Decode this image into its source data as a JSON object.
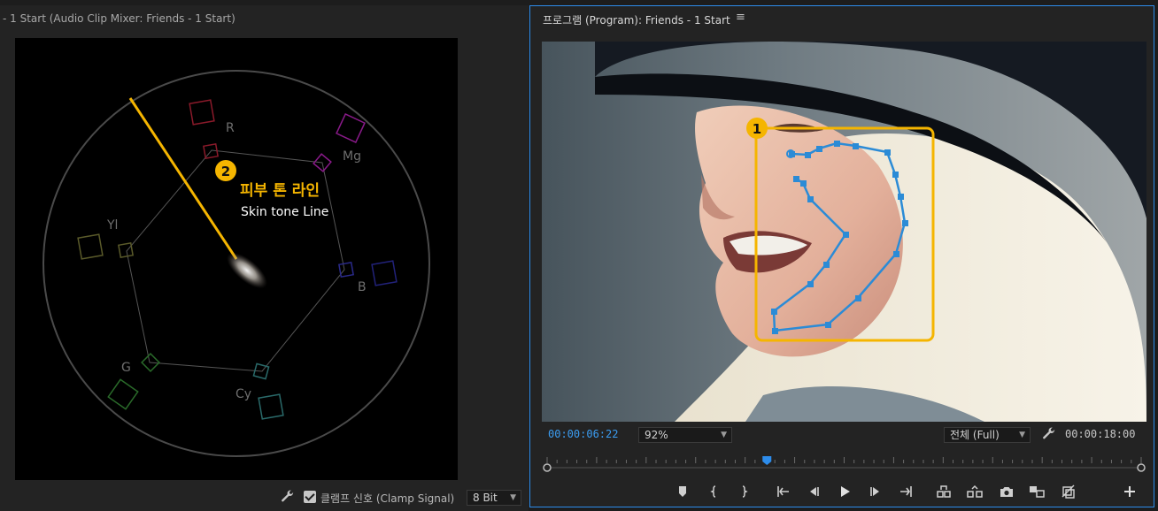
{
  "scope_panel": {
    "title": "- 1 Start (Audio Clip Mixer: Friends - 1 Start)",
    "targets": {
      "r": "R",
      "mg": "Mg",
      "b": "B",
      "cy": "Cy",
      "g": "G",
      "yl": "Yl"
    },
    "callout": {
      "number": "2",
      "title_ko": "피부 톤 라인",
      "title_en": "Skin tone Line"
    },
    "footer": {
      "clamp_label": "클램프 신호 (Clamp Signal)",
      "clamp_checked": true,
      "bit_depth": "8 Bit"
    },
    "colors": {
      "skin_line": "#f5b500",
      "accent": "#f5b500"
    }
  },
  "program_panel": {
    "title": "프로그램 (Program): Friends - 1 Start",
    "menu_icon": "hamburger-icon",
    "callout": {
      "number": "1"
    },
    "timecode_current": "00:00:06:22",
    "zoom": "92%",
    "quality": "전체 (Full)",
    "timecode_duration": "00:00:18:00",
    "playhead_fraction": 0.37,
    "controls": [
      "add-marker-icon",
      "mark-in-icon",
      "mark-out-icon",
      "go-to-in-icon",
      "step-back-icon",
      "play-icon",
      "step-forward-icon",
      "go-to-out-icon",
      "lift-icon",
      "extract-icon",
      "export-frame-icon",
      "compare-view-icon",
      "toggle-proxies-icon",
      "add-button-icon"
    ],
    "colors": {
      "accent_blue": "#2d8ceb",
      "mask": "#2b8bd6",
      "callout_border": "#f5b500"
    }
  }
}
